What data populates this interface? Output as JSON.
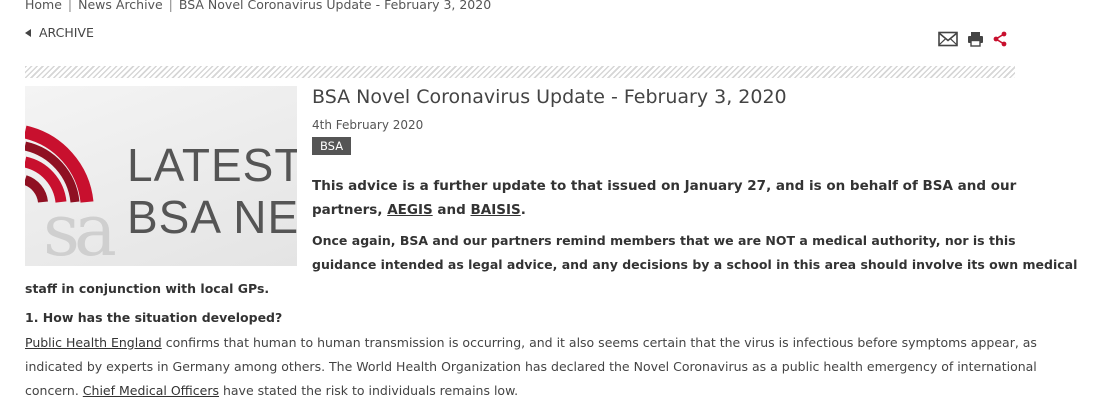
{
  "breadcrumb": {
    "home": "Home",
    "archive": "News Archive",
    "current": "BSA Novel Coronavirus Update - February 3, 2020"
  },
  "nav": {
    "archive_label": "ARCHIVE"
  },
  "tools": {
    "icons": [
      "mail-icon",
      "print-icon",
      "share-icon"
    ],
    "share_color": "#c8102e"
  },
  "thumbnail": {
    "line1": "LATEST",
    "line2": "BSA NEV",
    "watermark": "sa",
    "accent": "#c8102e"
  },
  "article": {
    "title": "BSA Novel Coronavirus Update - February 3, 2020",
    "date": "4th February 2020",
    "tag": "BSA",
    "intro": {
      "line1": "This advice is a further update to that issued on January 27, and is on behalf of BSA and our",
      "line2_pre": "partners, ",
      "link1": "AEGIS",
      "and": " and ",
      "link2": "BAISIS",
      "end": "."
    },
    "para2": {
      "line1": "Once again, BSA and our partners remind members that we are NOT a medical authority, nor is this",
      "line2": "guidance intended as legal advice, and any decisions by a school in this area should involve its own medical",
      "line3": "staff in conjunction with local GPs."
    },
    "heading1": "1. How has the situation developed?",
    "body": {
      "line1_link": "Public Health England",
      "line1_rest": " confirms that human to human transmission is occurring, and it also seems certain that the virus is infectious before symptoms appear, as",
      "line2": "indicated by experts in Germany among others. The World Health Organization has declared the Novel Coronavirus as a public health emergency of international",
      "line3_pre": "concern. ",
      "line3_link": "Chief Medical Officers",
      "line3_rest": " have stated the risk to individuals remains low."
    }
  }
}
